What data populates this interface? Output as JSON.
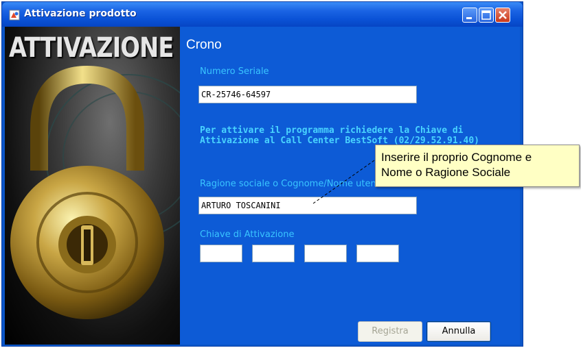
{
  "window": {
    "title": "Attivazione prodotto",
    "colors": {
      "frame": "#0b56c8",
      "accent_label": "#39c5ff",
      "tooltip_bg": "#ffffc4"
    }
  },
  "side_banner": {
    "word": "ATTIVAZIONE"
  },
  "product": {
    "name": "Crono"
  },
  "serial": {
    "label": "Numero Seriale",
    "value": "CR-25746-64597"
  },
  "info_text": {
    "line1": "Per attivare il programma richiedere la Chiave di",
    "line2": "Attivazione al Call Center BestSoft (02/29.52.91.40)"
  },
  "company": {
    "label": "Ragione sociale o Cognome/Nome utente",
    "value": "ARTURO TOSCANINI"
  },
  "activation_key": {
    "label": "Chiave di Attivazione",
    "parts": [
      "",
      "",
      "",
      ""
    ]
  },
  "buttons": {
    "register": "Registra",
    "cancel": "Annulla"
  },
  "tooltip": {
    "line1": "Inserire il proprio Cognome e",
    "line2": "Nome o Ragione Sociale"
  },
  "icons": [
    "lock-app-icon",
    "minimize-icon",
    "maximize-icon",
    "close-icon"
  ]
}
